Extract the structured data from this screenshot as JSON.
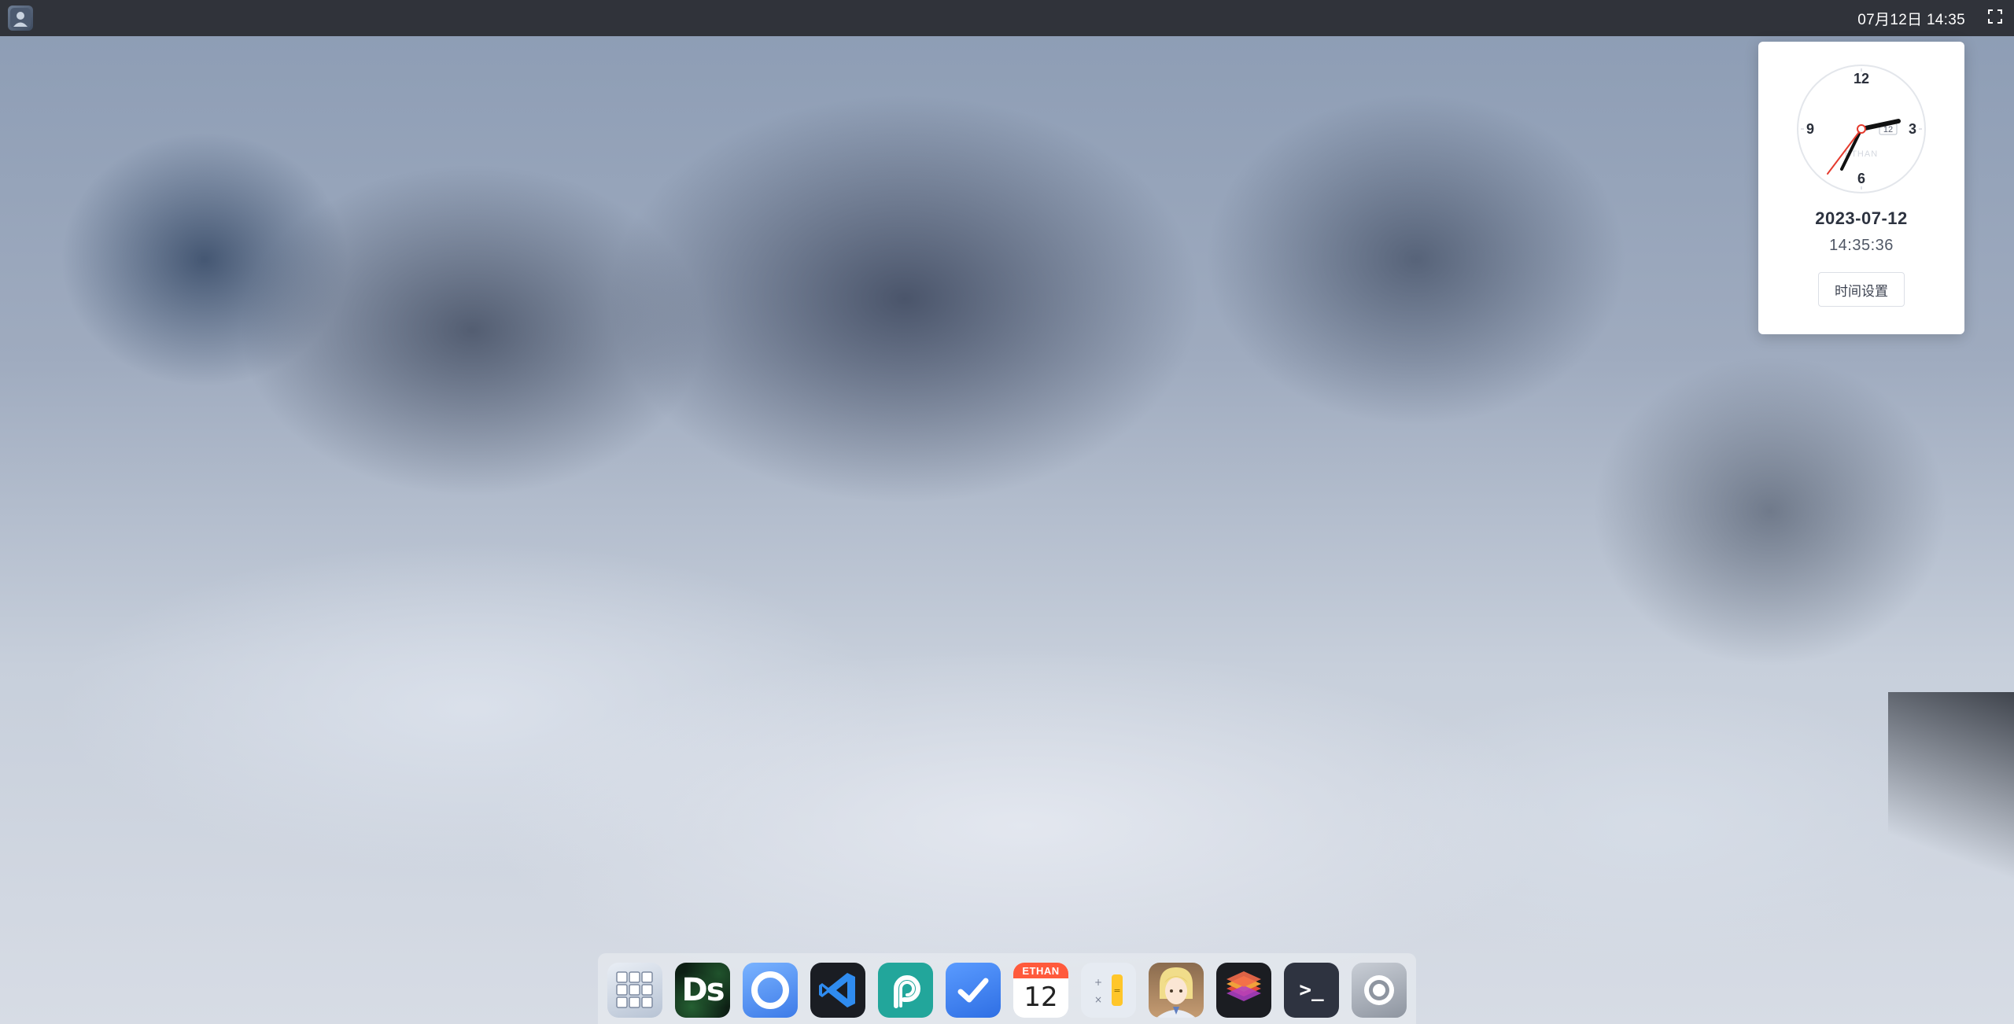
{
  "topbar": {
    "datetime": "07月12日 14:35",
    "avatar_icon": "user-avatar-icon",
    "fullscreen_icon": "fullscreen-icon"
  },
  "clock_widget": {
    "dial_numbers": {
      "twelve": "12",
      "three": "3",
      "six": "6",
      "nine": "9"
    },
    "date_window": "12",
    "brand": "ETHAN",
    "date": "2023-07-12",
    "time": "14:35:36",
    "settings_label": "时间设置"
  },
  "dock": {
    "items": [
      {
        "name": "launchpad",
        "icon": "app-grid-icon"
      },
      {
        "name": "dashboard",
        "label": "Ds"
      },
      {
        "name": "browser",
        "icon": "browser-ring-icon"
      },
      {
        "name": "vscode",
        "icon": "vscode-icon"
      },
      {
        "name": "pixso",
        "icon": "pixso-icon"
      },
      {
        "name": "todo",
        "icon": "checkmark-icon"
      },
      {
        "name": "calendar",
        "header": "ETHAN",
        "day": "12"
      },
      {
        "name": "calculator",
        "icon": "calculator-icon"
      },
      {
        "name": "profile",
        "icon": "anime-avatar-icon"
      },
      {
        "name": "layers",
        "icon": "layers-icon"
      },
      {
        "name": "terminal",
        "label": ">_"
      },
      {
        "name": "settings",
        "icon": "settings-ring-icon"
      }
    ]
  },
  "colors": {
    "topbar_bg": "#2a2c30",
    "calendar_header": "#ff5a3c",
    "vscode_blue": "#2f8cf0",
    "pixso_green": "#22a69b",
    "clock_second_hand": "#e53b2e"
  }
}
